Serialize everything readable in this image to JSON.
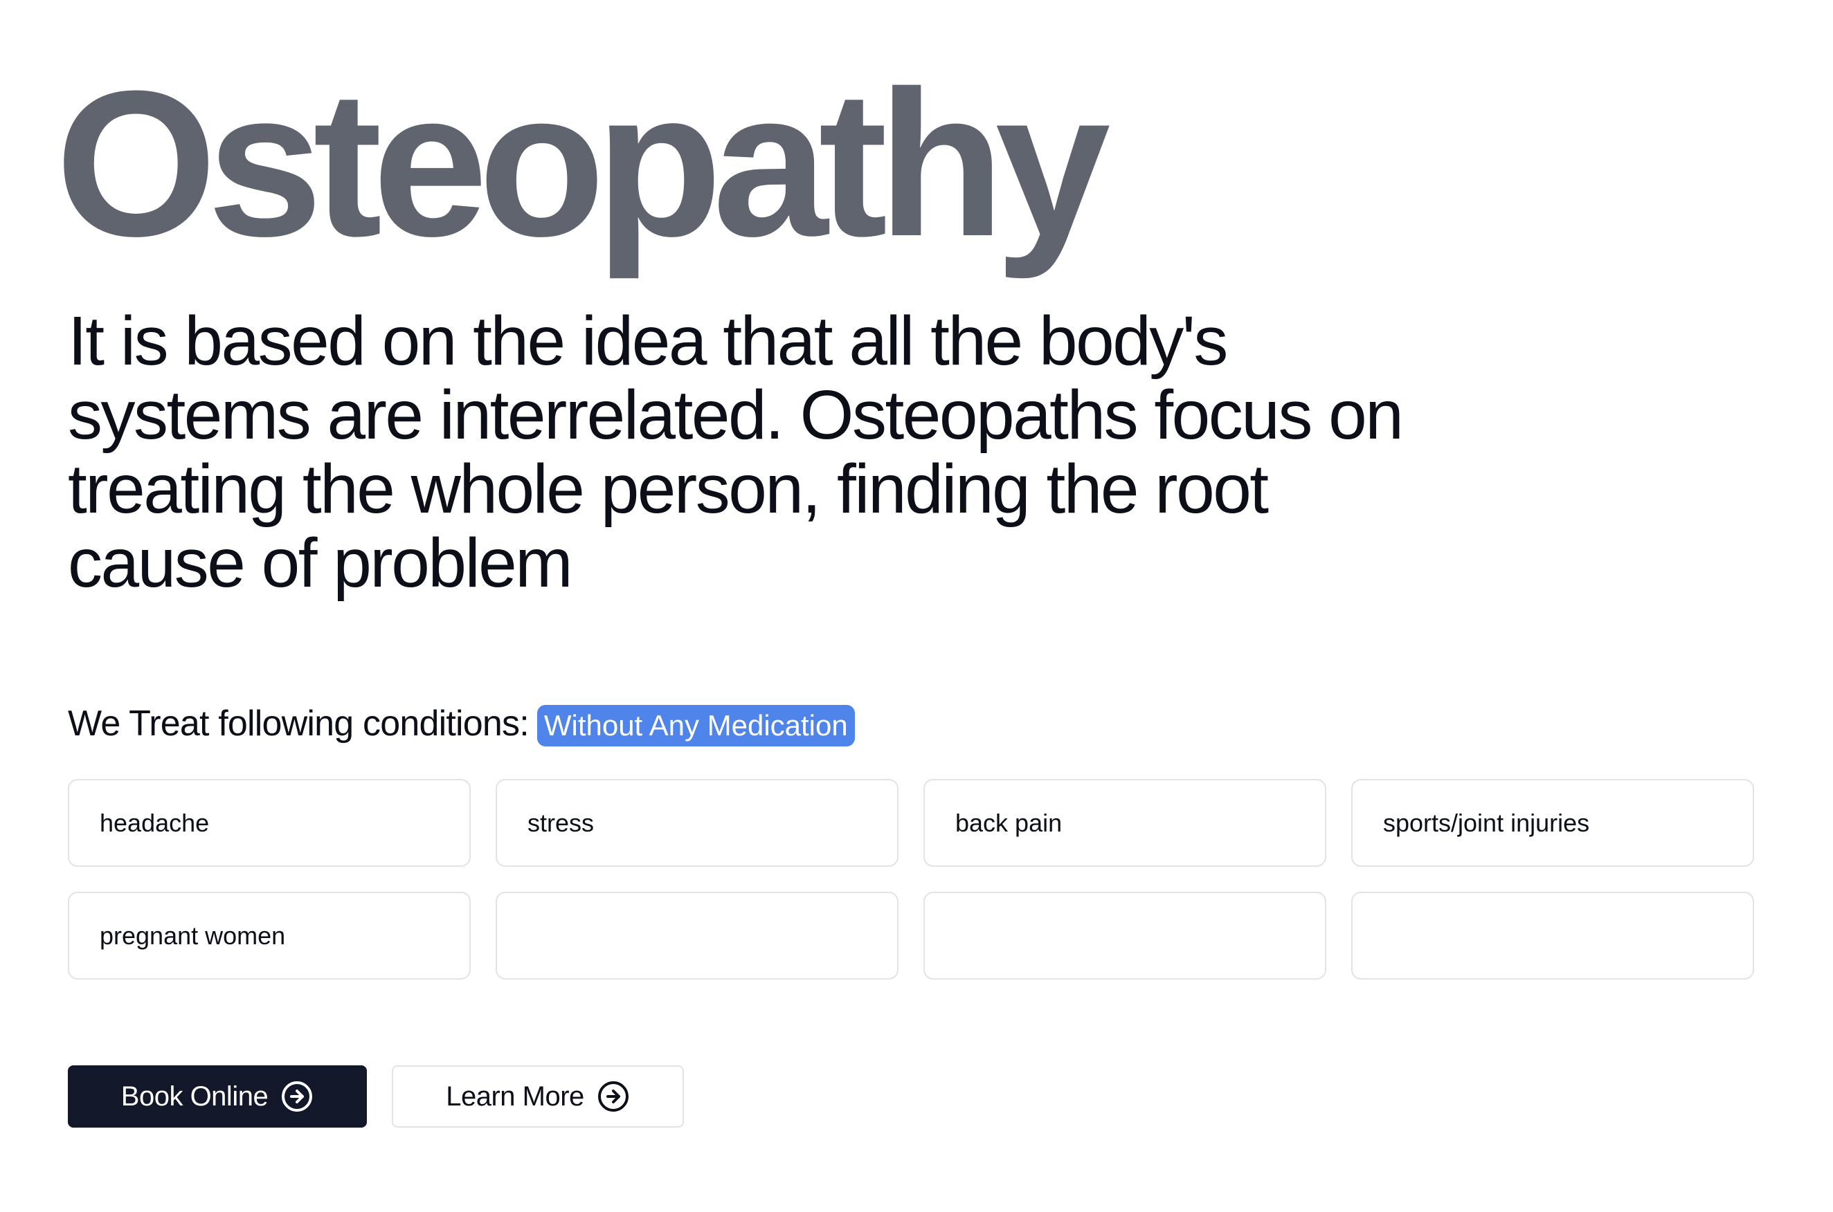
{
  "hero": {
    "title": "Osteopathy",
    "description": "It is based on the idea that all the body's systems are interrelated. Osteopaths focus on treating the whole person, finding the root cause of problem"
  },
  "conditions": {
    "label": "We Treat following conditions:",
    "badge": "Without Any Medication",
    "items": [
      "headache",
      "stress",
      "back pain",
      "sports/joint injuries",
      "pregnant women",
      "",
      "",
      ""
    ]
  },
  "actions": {
    "book_label": "Book Online",
    "learn_label": "Learn More"
  },
  "icons": {
    "book": "arrow-right-circle-icon",
    "learn": "arrow-right-circle-icon"
  },
  "colors": {
    "title": "#60646e",
    "badge_bg": "#4f84ea",
    "primary_button": "#121729",
    "card_border": "#e1e3e8"
  }
}
